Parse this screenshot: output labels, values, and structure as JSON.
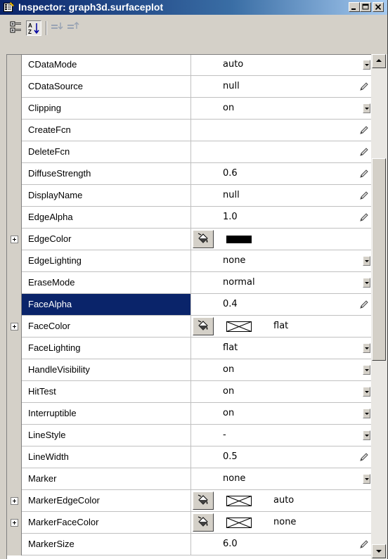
{
  "window": {
    "title": "Inspector: graph3d.surfaceplot",
    "icon": "inspector-window-icon",
    "controls": [
      "minimize-icon",
      "maximize-icon",
      "close-icon"
    ]
  },
  "toolbar": {
    "buttons": [
      {
        "name": "categorized-view-icon",
        "pressed": false
      },
      {
        "name": "sort-alphabetical-icon",
        "pressed": true
      },
      {
        "name": "expand-all-icon",
        "pressed": false
      },
      {
        "name": "collapse-all-icon",
        "pressed": false
      }
    ]
  },
  "properties": [
    {
      "name": "CDataMode",
      "value": "auto",
      "editor": "dropdown"
    },
    {
      "name": "CDataSource",
      "value": "null",
      "editor": "pencil"
    },
    {
      "name": "Clipping",
      "value": "on",
      "editor": "dropdown"
    },
    {
      "name": "CreateFcn",
      "value": "",
      "editor": "pencil"
    },
    {
      "name": "DeleteFcn",
      "value": "",
      "editor": "pencil"
    },
    {
      "name": "DiffuseStrength",
      "value": "0.6",
      "editor": "pencil"
    },
    {
      "name": "DisplayName",
      "value": "null",
      "editor": "pencil"
    },
    {
      "name": "EdgeAlpha",
      "value": "1.0",
      "editor": "pencil"
    },
    {
      "name": "EdgeColor",
      "value": "",
      "editor": "color",
      "expandable": true,
      "swatch": "#000000"
    },
    {
      "name": "EdgeLighting",
      "value": "none",
      "editor": "dropdown"
    },
    {
      "name": "EraseMode",
      "value": "normal",
      "editor": "dropdown"
    },
    {
      "name": "FaceAlpha",
      "value": "0.4",
      "editor": "pencil",
      "selected": true
    },
    {
      "name": "FaceColor",
      "value": "flat",
      "editor": "color",
      "expandable": true,
      "swatch": "none"
    },
    {
      "name": "FaceLighting",
      "value": "flat",
      "editor": "dropdown"
    },
    {
      "name": "HandleVisibility",
      "value": "on",
      "editor": "dropdown"
    },
    {
      "name": "HitTest",
      "value": "on",
      "editor": "dropdown"
    },
    {
      "name": "Interruptible",
      "value": "on",
      "editor": "dropdown"
    },
    {
      "name": "LineStyle",
      "value": "-",
      "editor": "dropdown"
    },
    {
      "name": "LineWidth",
      "value": "0.5",
      "editor": "pencil"
    },
    {
      "name": "Marker",
      "value": "none",
      "editor": "dropdown"
    },
    {
      "name": "MarkerEdgeColor",
      "value": "auto",
      "editor": "color",
      "expandable": true,
      "swatch": "none"
    },
    {
      "name": "MarkerFaceColor",
      "value": "none",
      "editor": "color",
      "expandable": true,
      "swatch": "none"
    },
    {
      "name": "MarkerSize",
      "value": "6.0",
      "editor": "pencil"
    }
  ],
  "colors": {
    "selection": "#0a246a",
    "titlebar_start": "#0a246a",
    "titlebar_end": "#a6caf0",
    "chrome": "#d4d0c8"
  }
}
